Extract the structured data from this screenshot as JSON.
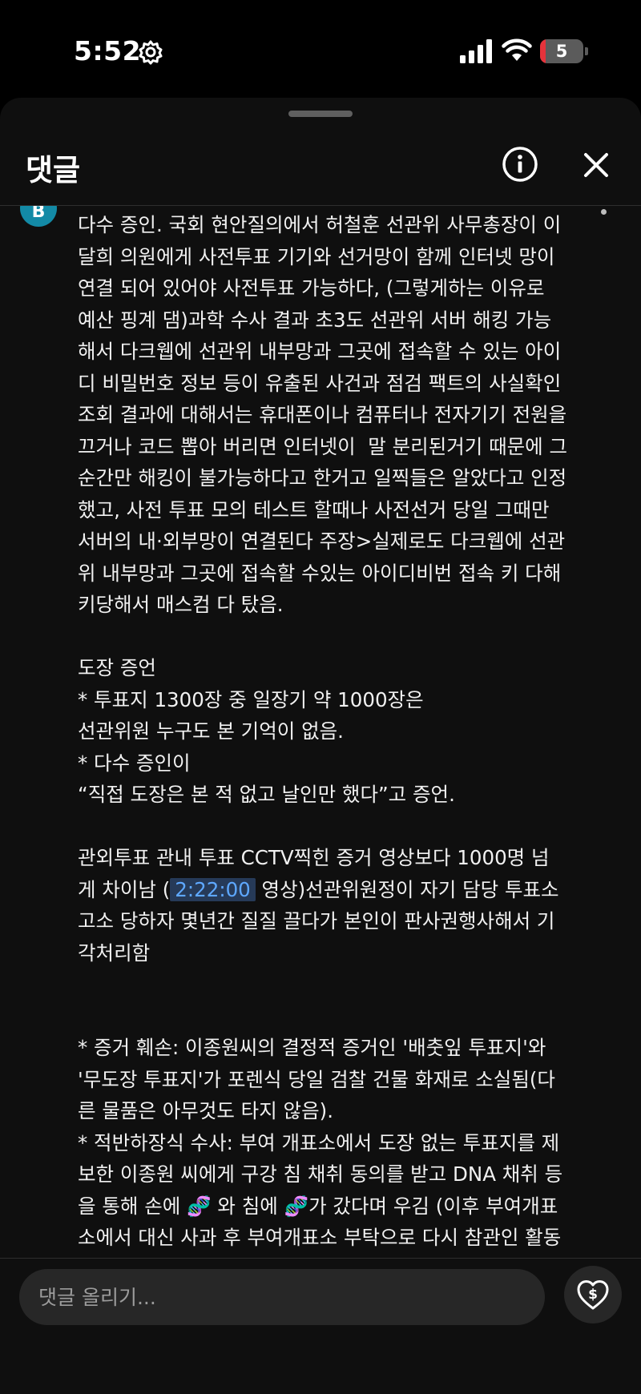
{
  "status_bar": {
    "time": "5:52",
    "battery_level": "5",
    "battery_fill_color": "#e5333b"
  },
  "header": {
    "title": "댓글",
    "icons": [
      "info-icon",
      "close-icon"
    ]
  },
  "comment": {
    "avatar_letter": "B",
    "before_timestamp": "다수 증인. 국회 현안질의에서 허철훈 선관위 사무총장이 이\n달희 의원에게 사전투표 기기와 선거망이 함께 인터넷 망이\n연결 되어 있어야 사전투표 가능하다, (그렇게하는 이유로\n예산 핑계 댐)과학 수사 결과 초3도 선관위 서버 해킹 가능\n해서 다크웹에 선관위 내부망과 그곳에 접속할 수 있는 아이\n디 비밀번호 정보 등이 유출된 사건과 점검 팩트의 사실확인\n조회 결과에 대해서는 휴대폰이나 컴퓨터나 전자기기 전원을\n끄거나 코드 뽑아 버리면 인터넷이  말 분리된거기 때문에 그\n순간만 해킹이 불가능하다고 한거고 일찍들은 알았다고 인정\n했고, 사전 투표 모의 테스트 할때나 사전선거 당일 그때만\n서버의 내·외부망이 연결된다 주장>실제로도 다크웹에 선관\n위 내부망과 그곳에 접속할 수있는 아이디비번 접속 키 다해\n키당해서 매스컴 다 탔음.\n\n도장 증언\n* 투표지 1300장 중 일장기 약 1000장은\n선관위원 누구도 본 기억이 없음.\n* 다수 증인이\n“직접 도장은 본 적 없고 날인만 했다”고 증언.\n\n관외투표 관내 투표 CCTV찍힌 증거 영상보다 1000명 넘\n게 차이남 (",
    "timestamp": "2:22:00",
    "mid_text": " 영상)선관위원정이 자기 담당 투표소\n고소 당하자 몇년간 질질 끌다가 본인이 판사권행사해서 기\n각처리함\n\n\n* 증거 훼손: 이종원씨의 결정적 증거인 '배춧잎 투표지'와\n'무도장 투표지'가 포렌식 당일 검찰 건물 화재로 소실됨(다\n른 물품은 아무것도 타지 않음).\n* 적반하장식 수사: 부여 개표소에서 도장 없는 투표지를 제\n보한 이종원 씨에게 구강 침 채취 동의를 받고 DNA 채취 등\n을 통해 손에 ",
    "emoji_1": "🧬",
    "mid_text_2": " 와 침에 ",
    "emoji_2": "🧬",
    "after_text": "가 갔다며 우김 (이후 부여개표\n소에서 대신 사과 후 부여개표소 부탁으로 다시 참관인 활동"
  },
  "composer": {
    "placeholder": "댓글 올리기...",
    "icon": "heart-dollar-icon"
  }
}
